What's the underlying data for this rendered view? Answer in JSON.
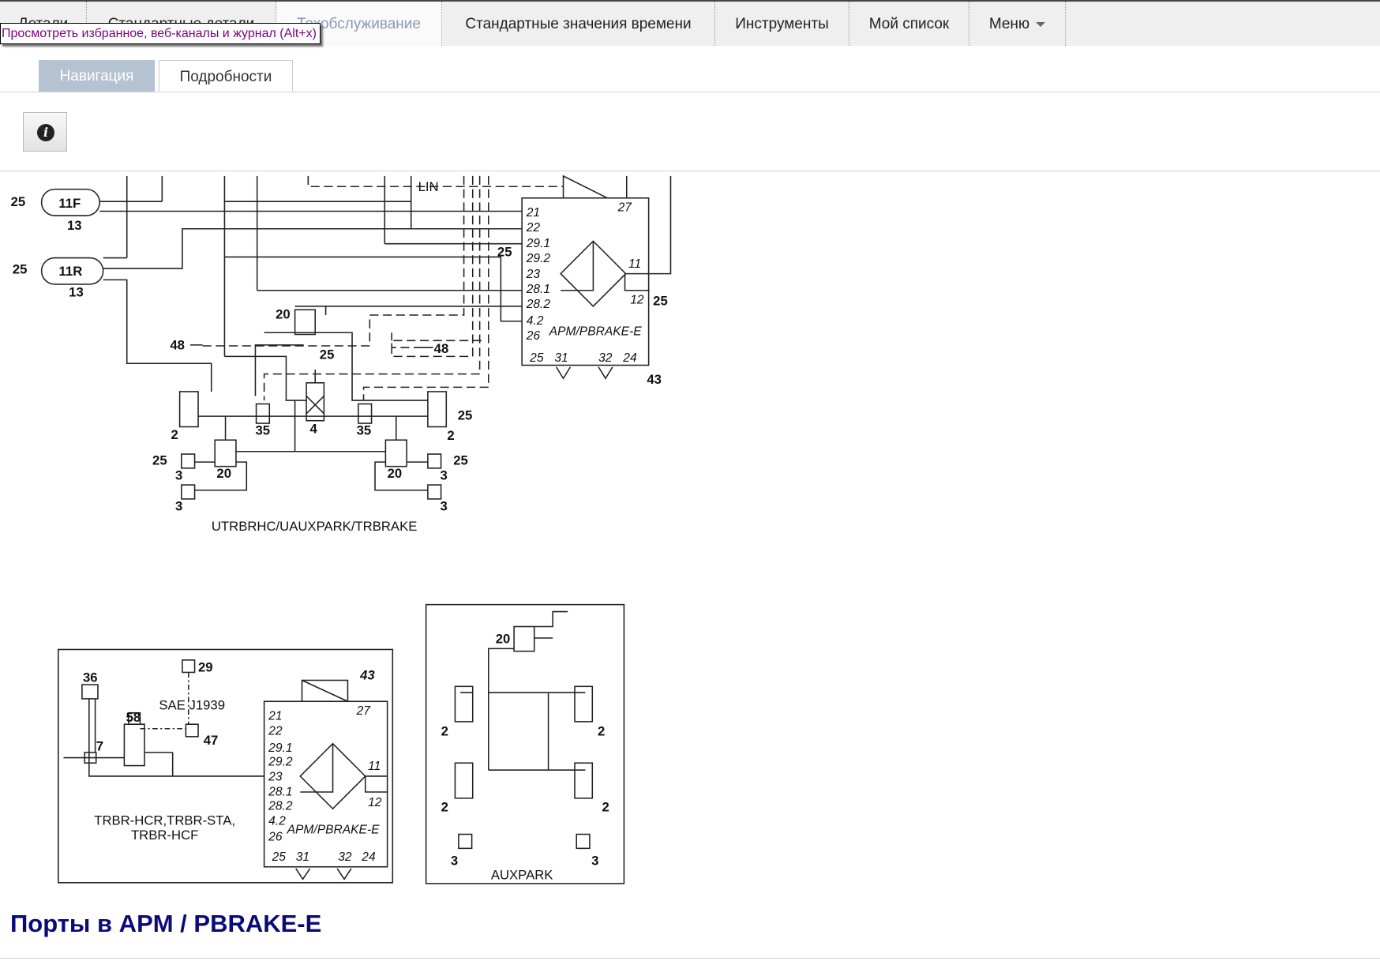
{
  "top_nav": {
    "tabs": [
      {
        "label": "Детали"
      },
      {
        "label": "Стандартные детали"
      },
      {
        "label": "Техобслуживание",
        "active": true
      },
      {
        "label": "Стандартные значения времени"
      },
      {
        "label": "Инструменты"
      },
      {
        "label": "Мой список"
      },
      {
        "label": "Меню"
      }
    ]
  },
  "tooltip": "Просмотреть избранное, веб-каналы и журнал (Alt+x)",
  "sub_tabs": {
    "navigation": "Навигация",
    "details": "Подробности"
  },
  "info_button": {
    "icon": "info-icon",
    "glyph": "i"
  },
  "diagram_main": {
    "caption": "UTRBRHC/UAUXPARK/TRBRAKE",
    "lin_label": "LIN",
    "apm_label": "APM/PBRAKE-E",
    "apm_number": "43",
    "ports": [
      "21",
      "22",
      "29.1",
      "29.2",
      "23",
      "28.1",
      "28.2",
      "4.2",
      "26"
    ],
    "top_port": "27",
    "right_ports": [
      "11",
      "12"
    ],
    "bottom_ports": [
      "25",
      "31",
      "32",
      "24"
    ],
    "tank_front": "11F",
    "tank_rear": "11R",
    "labels": [
      "25",
      "13",
      "25",
      "13",
      "25",
      "25",
      "20",
      "48",
      "48",
      "25",
      "35",
      "4",
      "35",
      "2",
      "2",
      "25",
      "20",
      "20",
      "25",
      "25",
      "3",
      "3",
      "3",
      "3"
    ]
  },
  "diagram_trbr": {
    "caption_line1": "TRBR-HCR,TRBR-STA,",
    "caption_line2": "TRBR-HCF",
    "bus_label": "SAE J1939",
    "apm_label": "APM/PBRAKE-E",
    "apm_number": "43",
    "ports": [
      "21",
      "22",
      "29.1",
      "29.2",
      "23",
      "28.1",
      "28.2",
      "4.2",
      "26"
    ],
    "top_port": "27",
    "right_ports": [
      "11",
      "12"
    ],
    "bottom_ports": [
      "25",
      "31",
      "32",
      "24"
    ],
    "labels": [
      "36",
      "29",
      "58",
      "47",
      "7"
    ]
  },
  "diagram_aux": {
    "caption": "AUXPARK",
    "labels": [
      "20",
      "2",
      "2",
      "2",
      "2",
      "3",
      "3"
    ]
  },
  "section_heading": "Порты в APM / PBRAKE-E"
}
